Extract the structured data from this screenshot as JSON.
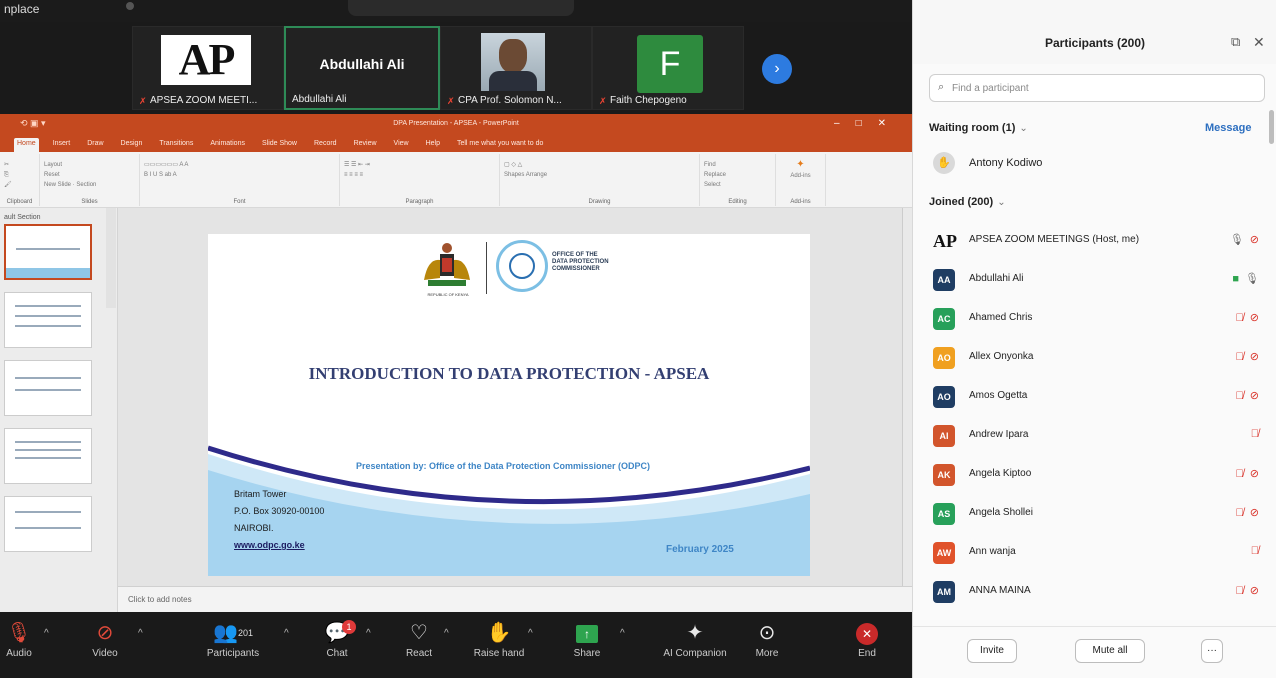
{
  "app": {
    "title": "nplace"
  },
  "video_strip": {
    "tiles": [
      {
        "name": "APSEA ZOOM MEETI...",
        "logo_text": "AP"
      },
      {
        "name": "Abdullahi Ali",
        "display_text": "Abdullahi Ali"
      },
      {
        "name": "CPA Prof. Solomon N..."
      },
      {
        "name": "Faith Chepogeno",
        "initial": "F"
      }
    ]
  },
  "ppt": {
    "window_title": "DPA Presentation - APSEA - PowerPoint",
    "tabs": [
      "Home",
      "Insert",
      "Draw",
      "Design",
      "Transitions",
      "Animations",
      "Slide Show",
      "Record",
      "Review",
      "View",
      "Help"
    ],
    "tell_me": "Tell me what you want to do",
    "ribbon_groups": [
      "Clipboard",
      "Slides",
      "Font",
      "Paragraph",
      "Drawing",
      "Editing",
      "Add-ins"
    ],
    "ribbon_items": {
      "new_slide": "New Slide",
      "layout": "Layout",
      "reset": "Reset",
      "section": "Section",
      "shapes": "Shapes",
      "arrange": "Arrange",
      "find": "Find",
      "replace": "Replace",
      "select": "Select",
      "addins": "Add-ins"
    },
    "section_label": "ault Section",
    "notes_placeholder": "Click to add notes"
  },
  "slide": {
    "coat_caption": "REPUBLIC OF KENYA",
    "office_line1": "OFFICE OF THE",
    "office_line2": "DATA PROTECTION",
    "office_line3": "COMMISSIONER",
    "title": "INTRODUCTION TO DATA PROTECTION - APSEA",
    "presenter": "Presentation by: Office of the Data Protection Commissioner (ODPC)",
    "addr1": "Britam Tower",
    "addr2": "P.O. Box 30920-00100",
    "addr3": "NAIROBI.",
    "url": "www.odpc.go.ke",
    "date": "February 2025"
  },
  "toolbar": {
    "audio": "Audio",
    "video": "Video",
    "participants": "Participants",
    "participants_count": "201",
    "chat": "Chat",
    "chat_badge": "1",
    "react": "React",
    "raise_hand": "Raise hand",
    "share": "Share",
    "ai_companion": "AI Companion",
    "more": "More",
    "end": "End"
  },
  "panel": {
    "title": "Participants (200)",
    "search_placeholder": "Find a participant",
    "waiting_label": "Waiting room (1)",
    "message_label": "Message",
    "waiting_person": "Antony Kodiwo",
    "joined_label": "Joined (200)",
    "participants": [
      {
        "initials": "AP",
        "name": "APSEA ZOOM MEETINGS (Host, me)",
        "color": "#ffffff",
        "logo": true,
        "mic": "on",
        "cam": "off"
      },
      {
        "initials": "AA",
        "name": "Abdullahi Ali",
        "color": "#1f3d63",
        "mic": "on",
        "cam": "on"
      },
      {
        "initials": "AC",
        "name": "Ahamed Chris",
        "color": "#27a05a",
        "mic": "muted",
        "cam": "off"
      },
      {
        "initials": "AO",
        "name": "Allex Onyonka",
        "color": "#f0a020",
        "mic": "muted",
        "cam": "off"
      },
      {
        "initials": "AO",
        "name": "Amos Ogetta",
        "color": "#1f3d63",
        "mic": "muted",
        "cam": "off"
      },
      {
        "initials": "AI",
        "name": "Andrew Ipara",
        "color": "#d2552c",
        "mic": "muted",
        "cam": "none"
      },
      {
        "initials": "AK",
        "name": "Angela Kiptoo",
        "color": "#d2552c",
        "mic": "muted",
        "cam": "off"
      },
      {
        "initials": "AS",
        "name": "Angela Shollei",
        "color": "#27a05a",
        "mic": "muted",
        "cam": "off"
      },
      {
        "initials": "AW",
        "name": "Ann wanja",
        "color": "#e0522a",
        "mic": "muted",
        "cam": "none"
      },
      {
        "initials": "AM",
        "name": "ANNA MAINA",
        "color": "#1f3d63",
        "mic": "muted",
        "cam": "off"
      }
    ],
    "invite_label": "Invite",
    "mute_all_label": "Mute all",
    "more_label": "···"
  },
  "colors": {
    "ppt_orange": "#c4491f",
    "zoom_blue": "#2d7be0",
    "mute_red": "#d9342b",
    "share_green": "#2ea44f"
  }
}
